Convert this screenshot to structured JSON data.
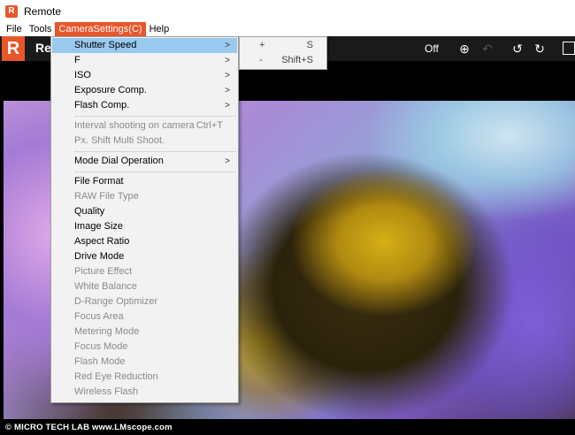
{
  "window": {
    "title": "Remote",
    "app_icon": "remote-app-icon"
  },
  "menubar": {
    "items": [
      {
        "label": "File"
      },
      {
        "label": "Tools"
      },
      {
        "label": "CameraSettings(C)"
      },
      {
        "label": "Help"
      }
    ],
    "active": "CameraSettings(C)"
  },
  "toolbar": {
    "logo": "R",
    "app_label": "Re",
    "off_label": "Off",
    "icons": [
      "zoom-in-icon",
      "undo-icon",
      "rotate-left-icon",
      "rotate-right-icon",
      "window-icon"
    ]
  },
  "dropdown": {
    "items": [
      {
        "label": "Shutter Speed",
        "submenu": true,
        "enabled": true,
        "highlighted": true
      },
      {
        "label": "F",
        "submenu": true,
        "enabled": true
      },
      {
        "label": "ISO",
        "submenu": true,
        "enabled": true
      },
      {
        "label": "Exposure Comp.",
        "submenu": true,
        "enabled": true
      },
      {
        "label": "Flash Comp.",
        "submenu": true,
        "enabled": true
      },
      {
        "label": "Interval shooting on camera",
        "shortcut": "Ctrl+T",
        "enabled": false
      },
      {
        "label": "Px. Shift Multi Shoot.",
        "enabled": false
      },
      {
        "label": "Mode Dial Operation",
        "submenu": true,
        "enabled": true
      },
      {
        "label": "File Format",
        "enabled": true
      },
      {
        "label": "RAW File Type",
        "enabled": false
      },
      {
        "label": "Quality",
        "enabled": true
      },
      {
        "label": "Image Size",
        "enabled": true
      },
      {
        "label": "Aspect Ratio",
        "enabled": true
      },
      {
        "label": "Drive Mode",
        "enabled": true
      },
      {
        "label": "Picture Effect",
        "enabled": false
      },
      {
        "label": "White Balance",
        "enabled": false
      },
      {
        "label": "D-Range Optimizer",
        "enabled": false
      },
      {
        "label": "Focus Area",
        "enabled": false
      },
      {
        "label": "Metering Mode",
        "enabled": false
      },
      {
        "label": "Focus Mode",
        "enabled": false
      },
      {
        "label": "Flash Mode",
        "enabled": false
      },
      {
        "label": "Red Eye Reduction",
        "enabled": false
      },
      {
        "label": "Wireless Flash",
        "enabled": false
      }
    ]
  },
  "submenu": {
    "items": [
      {
        "key": "+",
        "shortcut": "S"
      },
      {
        "key": "-",
        "shortcut": "Shift+S"
      }
    ]
  },
  "footer": {
    "watermark": "© MICRO TECH LAB www.LMscope.com"
  }
}
